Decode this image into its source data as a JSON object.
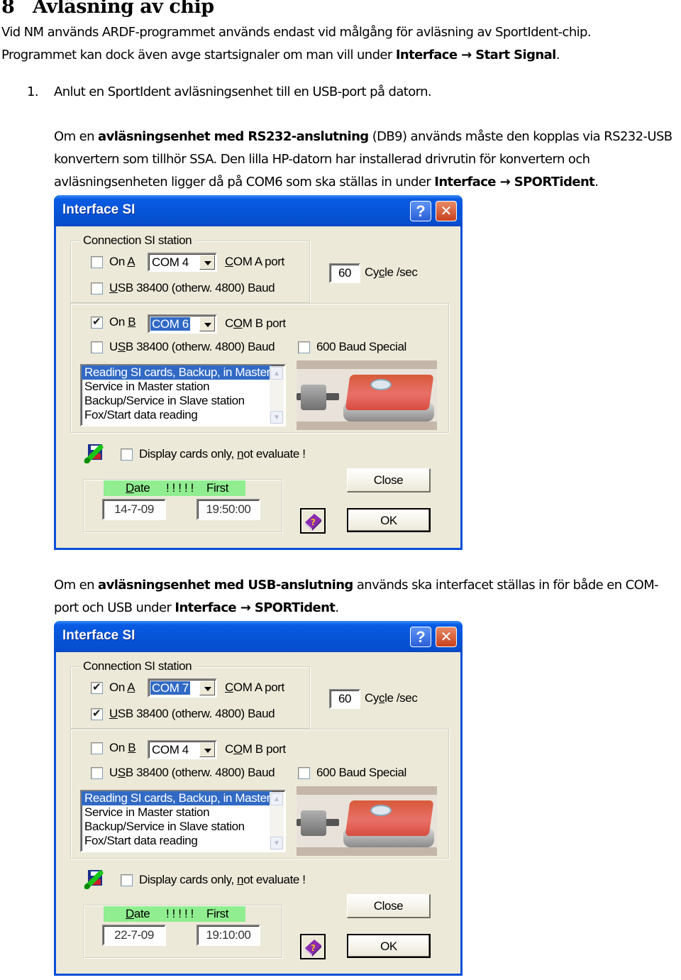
{
  "document": {
    "heading_number": "8",
    "heading_title": "Avläsning av chip",
    "intro_line1": "Vid NM används ARDF-programmet används endast vid målgång för avläsning av SportIdent-chip.",
    "intro_line2_pre": "Programmet kan dock även avge startsignaler om man vill under ",
    "intro_line2_bold": "Interface → Start Signal",
    "intro_line2_post": ".",
    "step1_number": "1.",
    "step1_text": "Anlut en SportIdent avläsningsenhet till en USB-port på datorn.",
    "para_rs232_pre": "Om en ",
    "para_rs232_bold": "avläsningsenhet med RS232-anslutning",
    "para_rs232_line1_post": " (DB9) används måste den kopplas via RS232-USB",
    "para_rs232_line2": "konvertern som tillhör SSA. Den lilla HP-datorn har installerad drivrutin för konvertern och",
    "para_rs232_line3_pre": "avläsningsenheten ligger då på COM6 som ska ställas in under  ",
    "para_rs232_line3_bold": "Interface → SPORTident",
    "para_rs232_line3_post": ".",
    "para_usb_pre": "Om en ",
    "para_usb_bold": "avläsningsenhet med USB-anslutning",
    "para_usb_line1_post": " används ska interfacet ställas in för både en COM-",
    "para_usb_line2_pre": "port och USB under  ",
    "para_usb_line2_bold": "Interface → SPORTident",
    "para_usb_line2_post": "."
  },
  "dialogs": [
    {
      "title": "Interface SI",
      "help_button": "?",
      "close_button": "✕",
      "group_label": "Connection SI station",
      "on_a": {
        "label_pre": "On ",
        "label_u": "A",
        "checked": false
      },
      "com_a": {
        "value": "COM 4",
        "selected": false
      },
      "com_a_label": {
        "u": "C",
        "rest": "OM A port"
      },
      "usb_a": {
        "label_u": "U",
        "label_rest": "SB 38400 (otherw. 4800) Baud",
        "checked": false
      },
      "cycle": {
        "value": "60",
        "label_pre": "Cy",
        "label_u": "c",
        "label_post": "le /sec"
      },
      "on_b": {
        "label_pre": "On ",
        "label_u": "B",
        "checked": true
      },
      "com_b": {
        "value": "COM 6",
        "selected": true
      },
      "com_b_label": {
        "pre": "C",
        "u": "O",
        "rest": "M B port"
      },
      "usb_b": {
        "label_pre": "U",
        "label_u": "S",
        "label_rest": "B 38400 (otherw. 4800) Baud",
        "checked": false
      },
      "baud600": {
        "label": "600 Baud Special",
        "checked": false
      },
      "mode_list": [
        "Reading SI cards, Backup, in Master station",
        "Service in Master station",
        "Backup/Service in Slave station",
        "Fox/Start data reading"
      ],
      "mode_selected_index": 0,
      "display_only": {
        "label_pre": "Display cards only, ",
        "label_u": "n",
        "label_post": "ot evaluate !",
        "checked": false
      },
      "date_header": {
        "u": "D",
        "rest": "ate",
        "mid": "! ! ! ! !",
        "first_time": "First time"
      },
      "date_value": "14-7-09",
      "time_value": "19:50:00",
      "close_label": "Close",
      "ok_label": "OK"
    },
    {
      "title": "Interface SI",
      "help_button": "?",
      "close_button": "✕",
      "group_label": "Connection SI station",
      "on_a": {
        "label_pre": "On ",
        "label_u": "A",
        "checked": true
      },
      "com_a": {
        "value": "COM 7",
        "selected": true
      },
      "com_a_label": {
        "u": "C",
        "rest": "OM A port"
      },
      "usb_a": {
        "label_u": "U",
        "label_rest": "SB 38400 (otherw. 4800) Baud",
        "checked": true
      },
      "cycle": {
        "value": "60",
        "label_pre": "Cy",
        "label_u": "c",
        "label_post": "le /sec"
      },
      "on_b": {
        "label_pre": "On ",
        "label_u": "B",
        "checked": false
      },
      "com_b": {
        "value": "COM 4",
        "selected": false
      },
      "com_b_label": {
        "pre": "C",
        "u": "O",
        "rest": "M B port"
      },
      "usb_b": {
        "label_pre": "U",
        "label_u": "S",
        "label_rest": "B 38400 (otherw. 4800) Baud",
        "checked": false
      },
      "baud600": {
        "label": "600 Baud Special",
        "checked": false
      },
      "mode_list": [
        "Reading SI cards, Backup, in Master station",
        "Service in Master station",
        "Backup/Service in Slave station",
        "Fox/Start data reading"
      ],
      "mode_selected_index": 0,
      "display_only": {
        "label_pre": "Display cards only, ",
        "label_u": "n",
        "label_post": "ot evaluate !",
        "checked": false
      },
      "date_header": {
        "u": "D",
        "rest": "ate",
        "mid": "! ! ! ! !",
        "first_time": "First time"
      },
      "date_value": "22-7-09",
      "time_value": "19:10:00",
      "close_label": "Close",
      "ok_label": "OK"
    }
  ]
}
